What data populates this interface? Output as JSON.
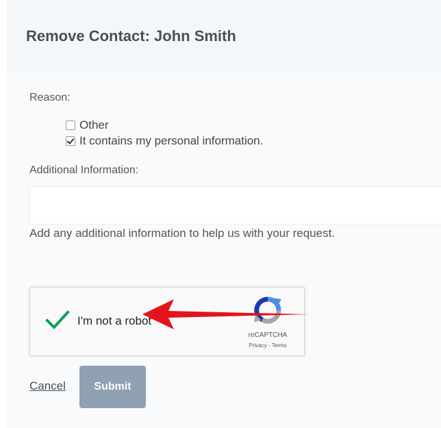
{
  "modal": {
    "title": "Remove Contact: John Smith"
  },
  "form": {
    "reason_label": "Reason:",
    "reasons": [
      {
        "label": "Other",
        "checked": false
      },
      {
        "label": "It contains my personal information.",
        "checked": true
      }
    ],
    "additional_label": "Additional Information:",
    "additional_value": "",
    "help_text": "Add any additional information to help us with your request."
  },
  "recaptcha": {
    "label": "I'm not a robot",
    "checked": true,
    "brand": "reCAPTCHA",
    "links": "Privacy - Terms",
    "check_color": "#0f9d58"
  },
  "actions": {
    "cancel_label": "Cancel",
    "submit_label": "Submit",
    "submit_color": "#8fa1b3"
  },
  "annotation": {
    "arrow_color": "#e3141b",
    "points_to": "submit-button"
  }
}
